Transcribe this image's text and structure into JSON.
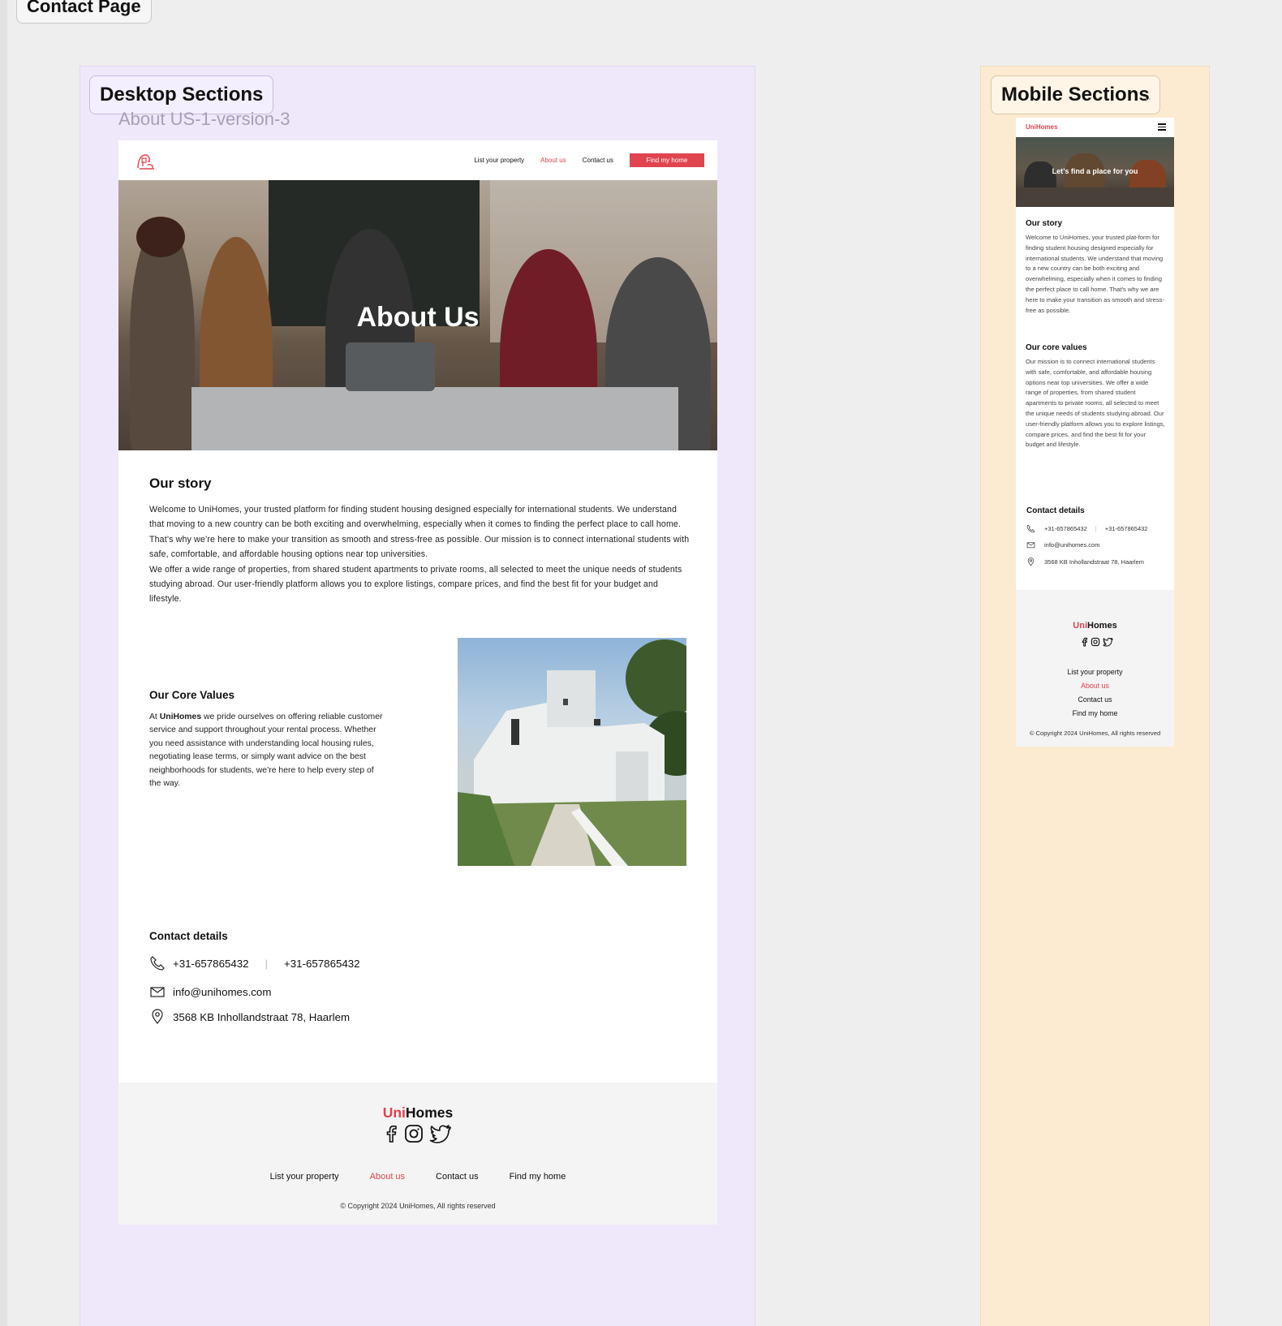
{
  "canvas": {
    "page_label": "Contact Page",
    "desktop_label": "Desktop Sections",
    "mobile_label": "Mobile Sections",
    "frame_name": "About US-1-version-3"
  },
  "colors": {
    "accent": "#e0444f",
    "desktop_section_bg": "#efe8fb",
    "mobile_section_bg": "#fcebd1",
    "footer_bg": "#f4f4f4"
  },
  "desktop": {
    "nav": {
      "logo_icon": "house-outline-icon",
      "links": [
        "List your property",
        "About us",
        "Contact us"
      ],
      "active_link": "About us",
      "cta": "Find my home"
    },
    "hero": {
      "title": "About Us"
    },
    "story": {
      "heading": "Our story",
      "paragraph_1": "Welcome to UniHomes, your trusted platform for finding student housing designed especially for international students. We understand that moving to a new country can be both exciting and overwhelming, especially when it comes to finding the perfect place to call home. That’s why we’re here to make your transition as smooth and stress-free as possible. Our mission is to connect international students with safe, comfortable, and affordable housing options near top universities.",
      "paragraph_2": "We offer a wide range of properties, from shared student apartments to private rooms, all selected to meet the unique needs of students studying abroad. Our user-friendly platform allows you to explore listings, compare prices, and find the best fit for your budget and lifestyle."
    },
    "core_values": {
      "heading": "Our Core Values",
      "text_before": "At ",
      "brand": "UniHomes",
      "text_after": " we pride ourselves on offering reliable customer service and support throughout your rental process. Whether you need assistance with understanding local housing rules, negotiating lease terms, or simply want advice on the best neighborhoods for students, we’re here to help every step of the way."
    },
    "contact": {
      "heading": "Contact details",
      "phone_1": "+31-657865432",
      "separator": "|",
      "phone_2": "+31-657865432",
      "email": "info@unihomes.com",
      "address": "3568 KB Inhollandstraat 78, Haarlem"
    },
    "footer": {
      "brand_uni": "Uni",
      "brand_homes": "Homes",
      "social_icons": [
        "facebook-icon",
        "instagram-icon",
        "twitter-icon"
      ],
      "links": [
        "List your property",
        "About us",
        "Contact us",
        "Find my home"
      ],
      "copyright": "© Copyright 2024 UniHomes, All rights reserved"
    }
  },
  "mobile": {
    "nav": {
      "brand": "UniHomes",
      "menu_icon": "hamburger-menu-icon"
    },
    "hero": {
      "title": "Let’s find a place for you"
    },
    "story": {
      "heading": "Our story",
      "text": "Welcome to UniHomes, your trusted plat-form for finding student housing designed especially for international students. We understand that moving to a new country can be both exciting and overwhelming, especially when it comes to finding the perfect place to call home. That’s why we are here to make your transition as smooth and stress-free as possible."
    },
    "core_values": {
      "heading": "Our core values",
      "text": "Our mission is to connect international students with safe, comfortable, and affordable housing options near top universities. We offer a wide range of properties, from shared student apartments to private rooms, all selected to meet the unique needs of students studying abroad. Our user-friendly platform allows you to explore listings, compare prices, and find the best fit for your budget and lifestyle."
    },
    "contact": {
      "heading": "Contact details",
      "phone_1": "+31-657865432",
      "separator": "|",
      "phone_2": "+31-657865432",
      "email": "info@unihomes.com",
      "address": "3568 KB Inhollandstraat 78, Haarlem"
    },
    "footer": {
      "brand_uni": "Uni",
      "brand_homes": "Homes",
      "links": [
        "List your property",
        "About us",
        "Contact us",
        "Find my home"
      ],
      "copyright": "© Copyright 2024 UniHomes, All rights reserved"
    }
  }
}
